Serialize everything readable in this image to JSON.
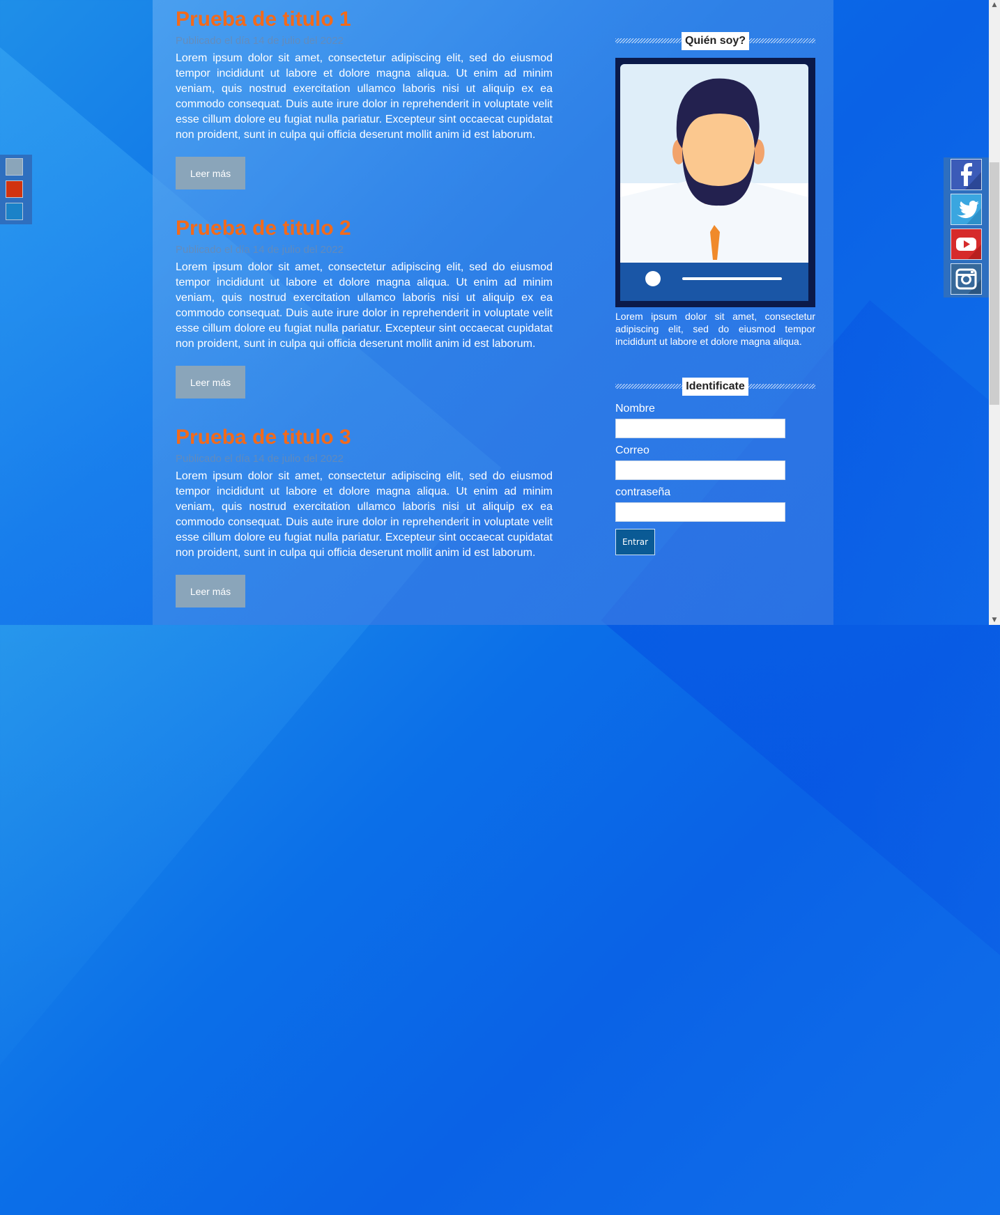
{
  "posts": [
    {
      "title": "Prueba de titulo 1",
      "date": "Publicado el día 14 de julio del 2022",
      "body": "Lorem ipsum dolor sit amet, consectetur adipiscing elit, sed do eiusmod tempor incididunt ut labore et dolore magna aliqua. Ut enim ad minim veniam, quis nostrud exercitation ullamco laboris nisi ut aliquip ex ea commodo consequat. Duis aute irure dolor in reprehenderit in voluptate velit esse cillum dolore eu fugiat nulla pariatur. Excepteur sint occaecat cupidatat non proident, sunt in culpa qui officia deserunt mollit anim id est laborum.",
      "button": "Leer más"
    },
    {
      "title": "Prueba de titulo 2",
      "date": "Publicado el día 14 de julio del 2022",
      "body": "Lorem ipsum dolor sit amet, consectetur adipiscing elit, sed do eiusmod tempor incididunt ut labore et dolore magna aliqua. Ut enim ad minim veniam, quis nostrud exercitation ullamco laboris nisi ut aliquip ex ea commodo consequat. Duis aute irure dolor in reprehenderit in voluptate velit esse cillum dolore eu fugiat nulla pariatur. Excepteur sint occaecat cupidatat non proident, sunt in culpa qui officia deserunt mollit anim id est laborum.",
      "button": "Leer más"
    },
    {
      "title": "Prueba de titulo 3",
      "date": "Publicado el día 14 de julio del 2022",
      "body": "Lorem ipsum dolor sit amet, consectetur adipiscing elit, sed do eiusmod tempor incididunt ut labore et dolore magna aliqua. Ut enim ad minim veniam, quis nostrud exercitation ullamco laboris nisi ut aliquip ex ea commodo consequat. Duis aute irure dolor in reprehenderit in voluptate velit esse cillum dolore eu fugiat nulla pariatur. Excepteur sint occaecat cupidatat non proident, sunt in culpa qui officia deserunt mollit anim id est laborum.",
      "button": "Leer más"
    }
  ],
  "sidebar": {
    "about": {
      "heading": "Quién soy?",
      "text": "Lorem ipsum dolor sit amet, consectetur adipiscing elit, sed do eiusmod tempor incididunt ut labore et dolore magna aliqua."
    },
    "login": {
      "heading": "Identificate",
      "name_label": "Nombre",
      "email_label": "Correo",
      "password_label": "contraseña",
      "submit": "Entrar"
    }
  },
  "theme_swatches": [
    "#8aa5ba",
    "#d1330f",
    "#1b82c8"
  ],
  "social": [
    {
      "icon": "facebook-icon",
      "color": "#3b5bb8"
    },
    {
      "icon": "twitter-icon",
      "color": "#3aa6e0"
    },
    {
      "icon": "youtube-icon",
      "color": "#d62b2b"
    },
    {
      "icon": "instagram-icon",
      "color": "#36689a"
    }
  ],
  "colors": {
    "title": "#f26a1b",
    "button": "#8aa5ba",
    "submit": "#0a5a95"
  }
}
